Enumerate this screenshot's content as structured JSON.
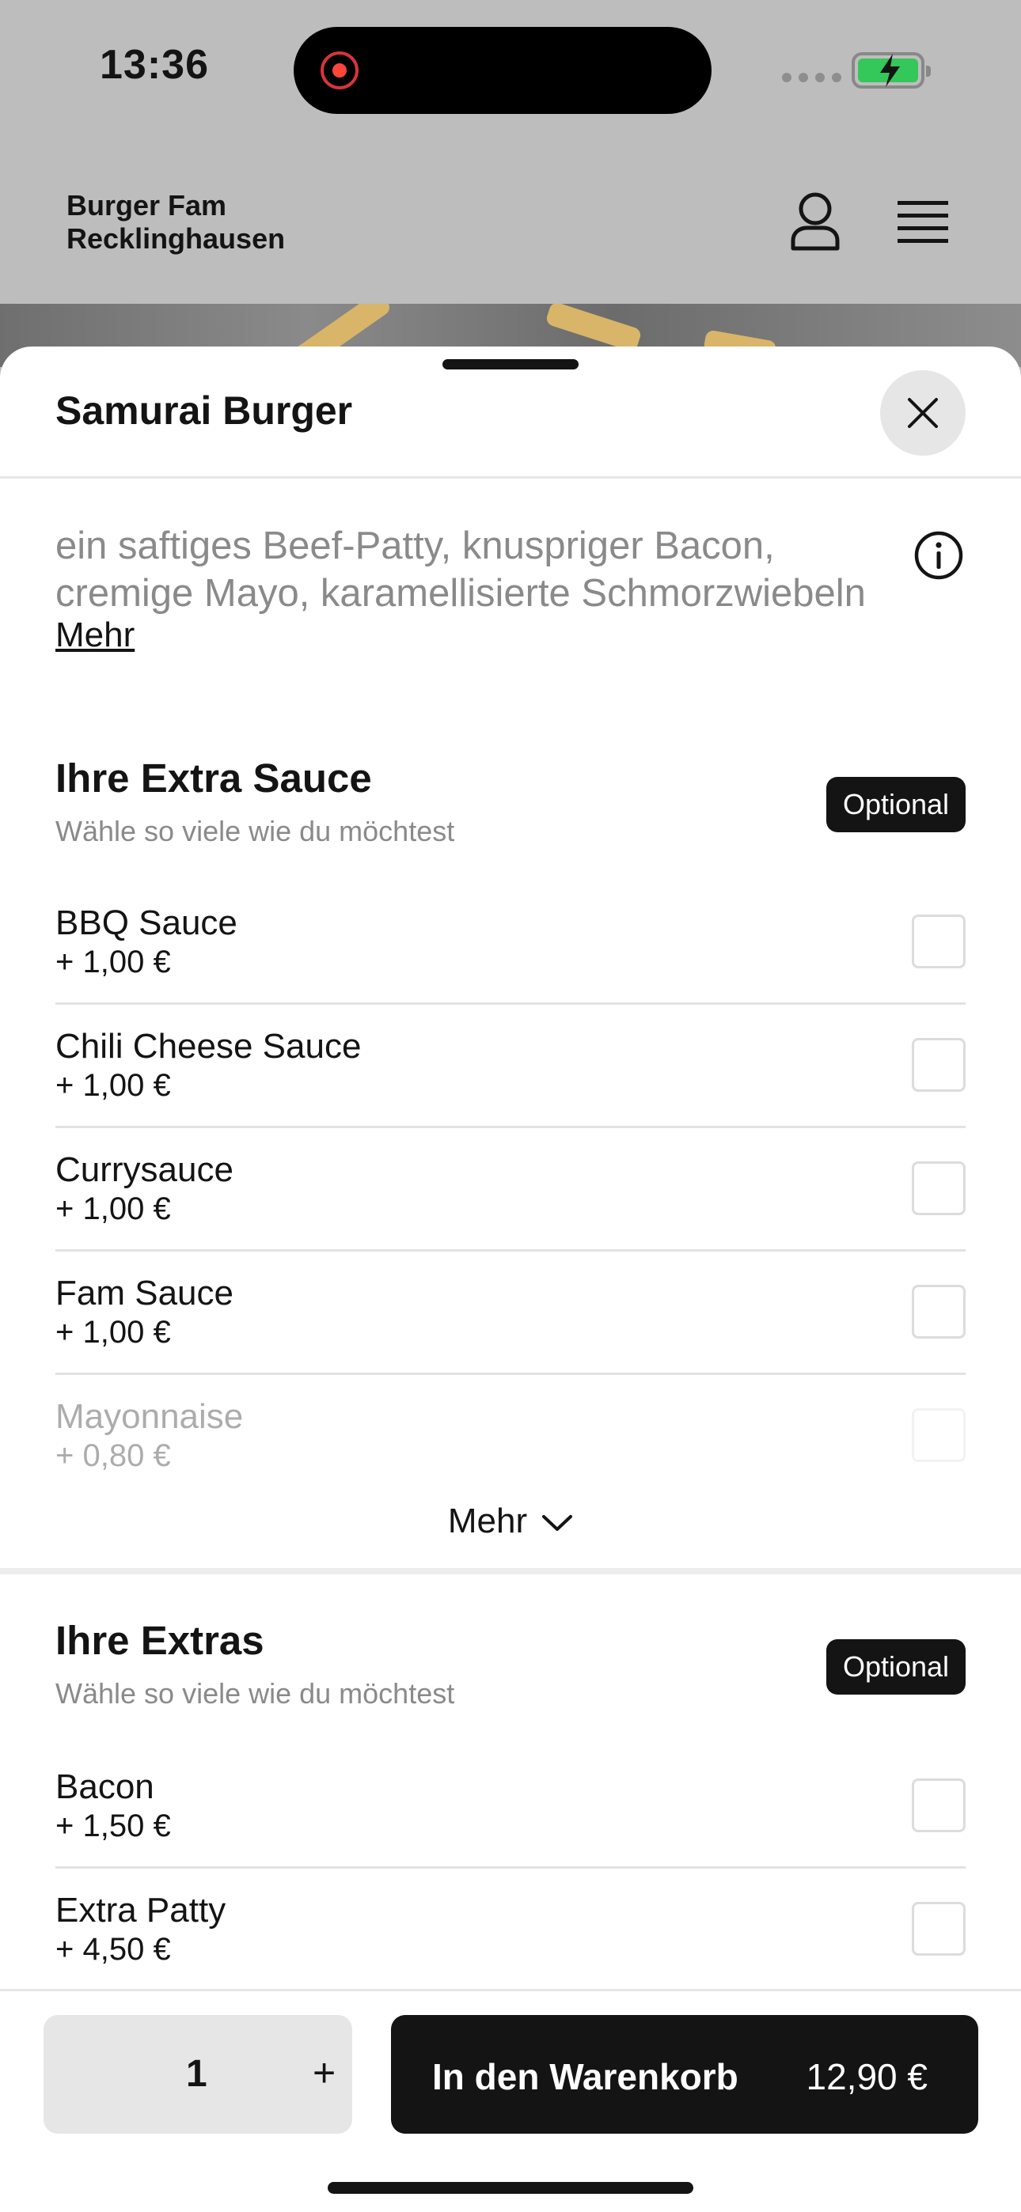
{
  "status_bar": {
    "time": "13:36"
  },
  "header": {
    "brand": "Burger Fam\nRecklinghausen"
  },
  "sheet": {
    "title": "Samurai Burger",
    "description": "ein saftiges Beef-Patty, knuspriger Bacon, cremige Mayo, karamellisierte Schmorzwiebeln",
    "more_label": "Mehr"
  },
  "sections": [
    {
      "title": "Ihre Extra Sauce",
      "subtitle": "Wähle so viele wie du möchtest",
      "badge": "Optional",
      "options": [
        {
          "name": "BBQ Sauce",
          "price": "+ 1,00 €",
          "checked": false
        },
        {
          "name": "Chili Cheese Sauce",
          "price": "+ 1,00 €",
          "checked": false
        },
        {
          "name": "Currysauce",
          "price": "+ 1,00 €",
          "checked": false
        },
        {
          "name": "Fam Sauce",
          "price": "+ 1,00 €",
          "checked": false
        },
        {
          "name": "Mayonnaise",
          "price": "+ 0,80 €",
          "checked": false
        }
      ],
      "more_label": "Mehr"
    },
    {
      "title": "Ihre Extras",
      "subtitle": "Wähle so viele wie du möchtest",
      "badge": "Optional",
      "options": [
        {
          "name": "Bacon",
          "price": "+ 1,50 €",
          "checked": false
        },
        {
          "name": "Extra Patty",
          "price": "+ 4,50 €",
          "checked": false
        }
      ]
    }
  ],
  "footer": {
    "quantity": "1",
    "plus": "+",
    "cart_label": "In den Warenkorb",
    "cart_price": "12,90 €"
  },
  "colors": {
    "accent": "#141414",
    "battery": "#34c759",
    "recording": "#ff453a"
  }
}
